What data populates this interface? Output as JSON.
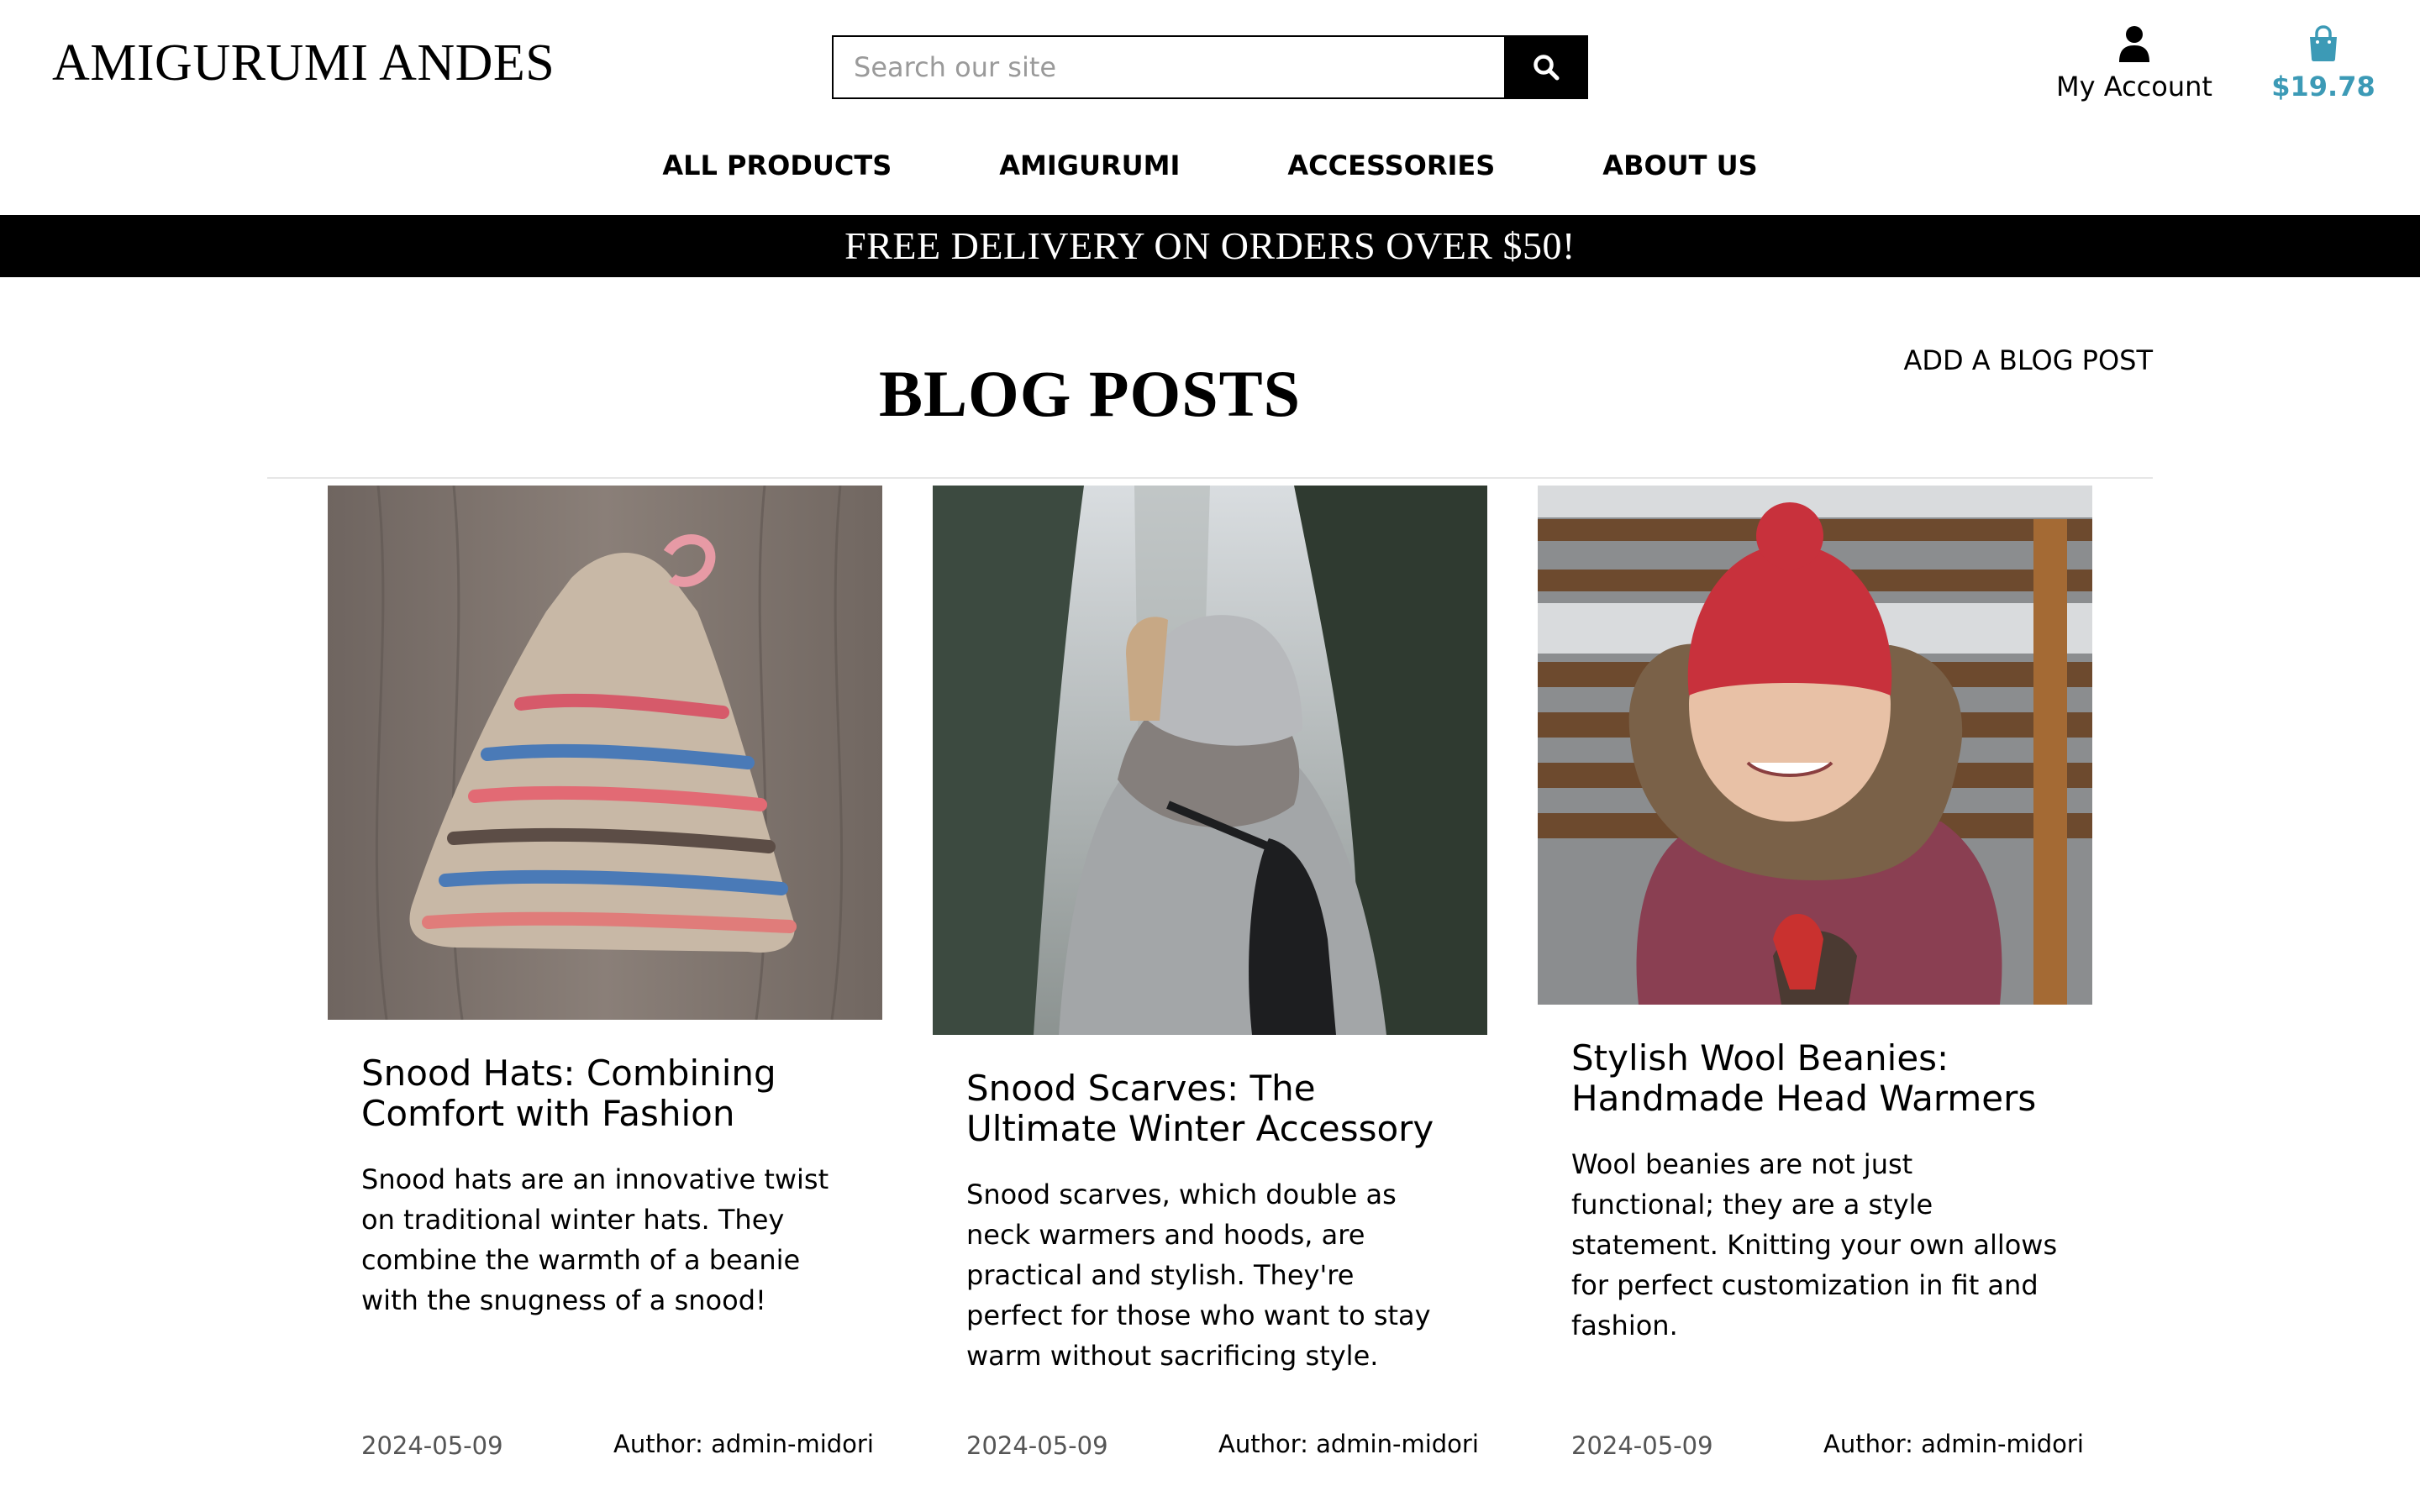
{
  "header": {
    "brand": "AMIGURUMI ANDES",
    "search_placeholder": "Search our site",
    "account_label": "My Account",
    "cart_total": "$19.78",
    "cart_color": "#3c9ab6"
  },
  "nav": {
    "items": [
      {
        "label": "ALL PRODUCTS"
      },
      {
        "label": "AMIGURUMI"
      },
      {
        "label": "ACCESSORIES"
      },
      {
        "label": "ABOUT US"
      }
    ]
  },
  "banner": {
    "text": "FREE DELIVERY ON ORDERS OVER $50!"
  },
  "main": {
    "title": "BLOG POSTS",
    "add_post_label": "ADD A BLOG POST"
  },
  "posts": [
    {
      "title": "Snood Hats: Combining Comfort with Fashion",
      "excerpt": "Snood hats are an innovative twist on traditional winter hats. They combine the warmth of a beanie with the snugness of a snood!",
      "date": "2024-05-09",
      "author": "Author: admin-midori",
      "image_subject": "crochet-snood-hat-photo"
    },
    {
      "title": "Snood Scarves: The Ultimate Winter Accessory",
      "excerpt": "Snood scarves, which double as neck warmers and hoods, are practical and stylish. They're perfect for those who want to stay warm without sacrificing style.",
      "date": "2024-05-09",
      "author": "Author: admin-midori",
      "image_subject": "woman-wearing-snood-scarf-photo"
    },
    {
      "title": "Stylish Wool Beanies: Handmade Head Warmers",
      "excerpt": "Wool beanies are not just functional; they are a style statement. Knitting your own allows for perfect customization in fit and fashion.",
      "date": "2024-05-09",
      "author": "Author: admin-midori",
      "image_subject": "girl-in-red-beanie-photo"
    }
  ]
}
